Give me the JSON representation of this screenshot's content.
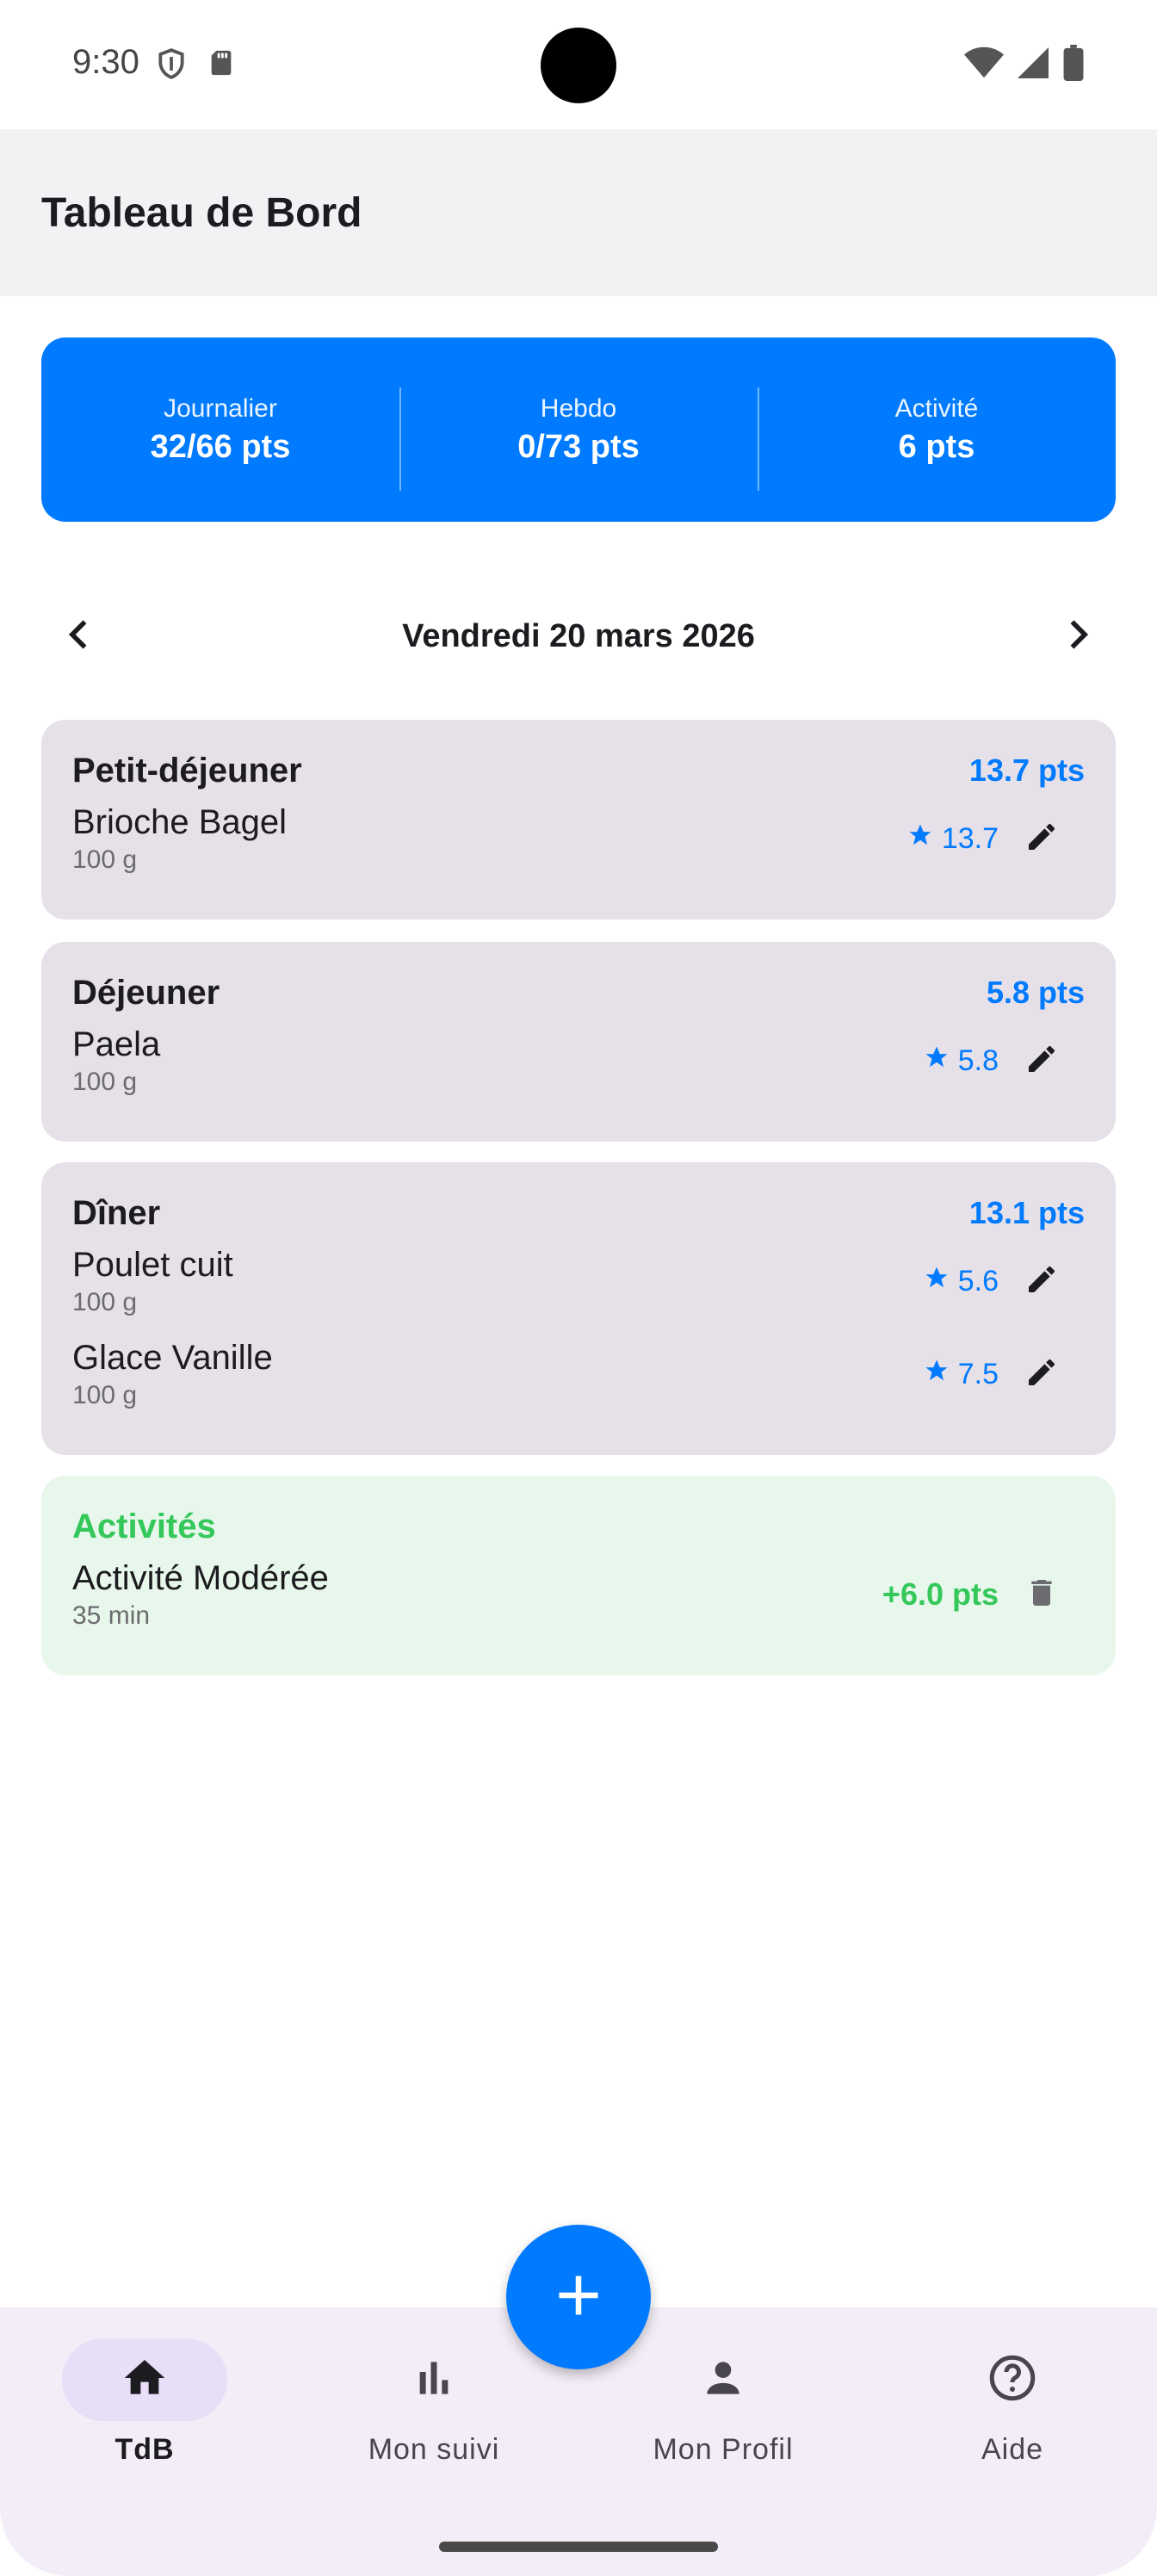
{
  "status": {
    "time": "9:30"
  },
  "app": {
    "title": "Tableau de Bord"
  },
  "summary": [
    {
      "label": "Journalier",
      "value": "32/66 pts"
    },
    {
      "label": "Hebdo",
      "value": "0/73 pts"
    },
    {
      "label": "Activité",
      "value": "6 pts"
    }
  ],
  "date": {
    "label": "Vendredi 20 mars 2026"
  },
  "meals": [
    {
      "name": "Petit-déjeuner",
      "points": "13.7 pts",
      "items": [
        {
          "name": "Brioche Bagel",
          "qty": "100 g",
          "score": "13.7"
        }
      ]
    },
    {
      "name": "Déjeuner",
      "points": "5.8 pts",
      "items": [
        {
          "name": "Paela",
          "qty": "100 g",
          "score": "5.8"
        }
      ]
    },
    {
      "name": "Dîner",
      "points": "13.1 pts",
      "items": [
        {
          "name": "Poulet cuit",
          "qty": "100 g",
          "score": "5.6"
        },
        {
          "name": "Glace Vanille",
          "qty": "100 g",
          "score": "7.5"
        }
      ]
    }
  ],
  "activities": {
    "title": "Activités",
    "items": [
      {
        "name": "Activité Modérée",
        "duration": "35 min",
        "points": "+6.0 pts"
      }
    ]
  },
  "fab": {
    "icon": "plus-icon"
  },
  "nav": [
    {
      "label": "TdB",
      "icon": "home-icon",
      "active": true
    },
    {
      "label": "Mon suivi",
      "icon": "bar-chart-icon",
      "active": false
    },
    {
      "label": "Mon Profil",
      "icon": "person-icon",
      "active": false
    },
    {
      "label": "Aide",
      "icon": "help-icon",
      "active": false
    }
  ],
  "colors": {
    "primary": "#007aff",
    "activity": "#34c759",
    "card": "#e6e0e8",
    "nav_bg": "#f3edf7"
  }
}
